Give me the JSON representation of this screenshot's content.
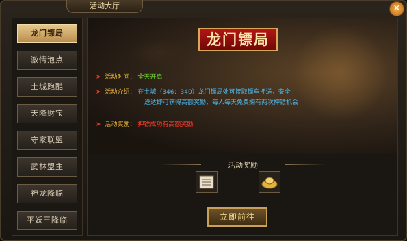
{
  "window": {
    "title": "活动大厅",
    "close_icon": "close-icon"
  },
  "sidebar": {
    "items": [
      {
        "label": "龙门镖局",
        "active": true
      },
      {
        "label": "激情泡点",
        "active": false
      },
      {
        "label": "土城跑酷",
        "active": false
      },
      {
        "label": "天降财宝",
        "active": false
      },
      {
        "label": "守家联盟",
        "active": false
      },
      {
        "label": "武林盟主",
        "active": false
      },
      {
        "label": "神龙降临",
        "active": false
      },
      {
        "label": "平妖王降临",
        "active": false
      }
    ]
  },
  "event": {
    "title": "龙门镖局",
    "time_label": "活动时间：",
    "time_value": "全天开启",
    "intro_label": "活动介绍：",
    "intro_line1": "在土城（346：340）龙门镖局处可接取镖车押送，安全",
    "intro_line2": "送达即可获得高额奖励，每人每天免费拥有两次押镖机会",
    "reward_label": "活动奖励：",
    "reward_value": "押镖成功有高额奖励"
  },
  "rewards": {
    "header": "活动奖励",
    "items": [
      "reward-scroll-icon",
      "gold-ingot-icon"
    ]
  },
  "actions": {
    "go_label": "立即前往"
  }
}
